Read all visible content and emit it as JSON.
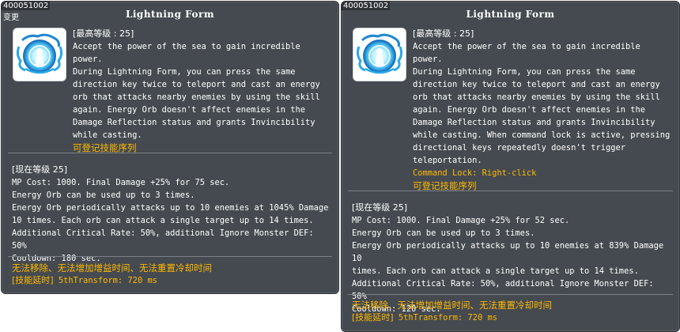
{
  "left": {
    "skill_id": "400051002",
    "changed_label": "变更",
    "title": "Lightning Form",
    "max_level": "[最高等级 : 25]",
    "description": "Accept the power of the sea to gain incredible power.\nDuring Lightning Form, you can press the same\ndirection key twice to teleport and cast an energy\norb that attacks nearby enemies by using the skill\nagain. Energy Orb doesn't affect enemies in the\nDamage Reflection status and grants Invincibility\nwhile casting.",
    "link_skill_text": "可登记技能序列",
    "current_level": "[现在等级 25]",
    "current_body": "MP Cost: 1000. Final Damage +25% for 75 sec.\nEnergy Orb can be used up to 3 times.\nEnergy Orb periodically attacks up to 10 enemies at 1045% Damage\n10 times. Each orb can attack a single target up to 14 times.\nAdditional Critical Rate: 50%, additional Ignore Monster DEF: 50%\nCooldown: 180 sec.",
    "restrictions": "无法移除、无法增加增益时间、无法重置冷却时间",
    "delay_label": "[技能延时]",
    "delay_value": " 5thTransform: 720 ms"
  },
  "right": {
    "skill_id": "400051002",
    "title": "Lightning Form",
    "max_level": "[最高等级 : 25]",
    "description": "Accept the power of the sea to gain incredible power.\nDuring Lightning Form, you can press the same\ndirection key twice to teleport and cast an energy\norb that attacks nearby enemies by using the skill\nagain. Energy Orb doesn't affect enemies in the\nDamage Reflection status and grants Invincibility\nwhile casting. When command lock is active, pressing\ndirectional keys repeatedly doesn't trigger\nteleportation.",
    "command_lock": "Command Lock: Right-click",
    "link_skill_text": "可登记技能序列",
    "current_level": "[现在等级 25]",
    "current_body": "MP Cost: 1000. Final Damage +25% for 52 sec.\nEnergy Orb can be used up to 3 times.\nEnergy Orb periodically attacks up to 10 enemies at 839% Damage 10\ntimes. Each orb can attack a single target up to 14 times.\nAdditional Critical Rate: 50%, additional Ignore Monster DEF: 50%\nCooldown: 120 sec.",
    "restrictions": "无法移除、无法增加增益时间、无法重置冷却时间",
    "delay_label": "[技能延时]",
    "delay_value": " 5thTransform: 720 ms"
  },
  "icon": {
    "name": "lightning-form-skill-icon",
    "accent": "#2aa7e8",
    "glow": "#bdf3ff"
  },
  "colors": {
    "panel_bg": "#454a50",
    "highlight": "#ffb900",
    "text": "#ffffff"
  }
}
